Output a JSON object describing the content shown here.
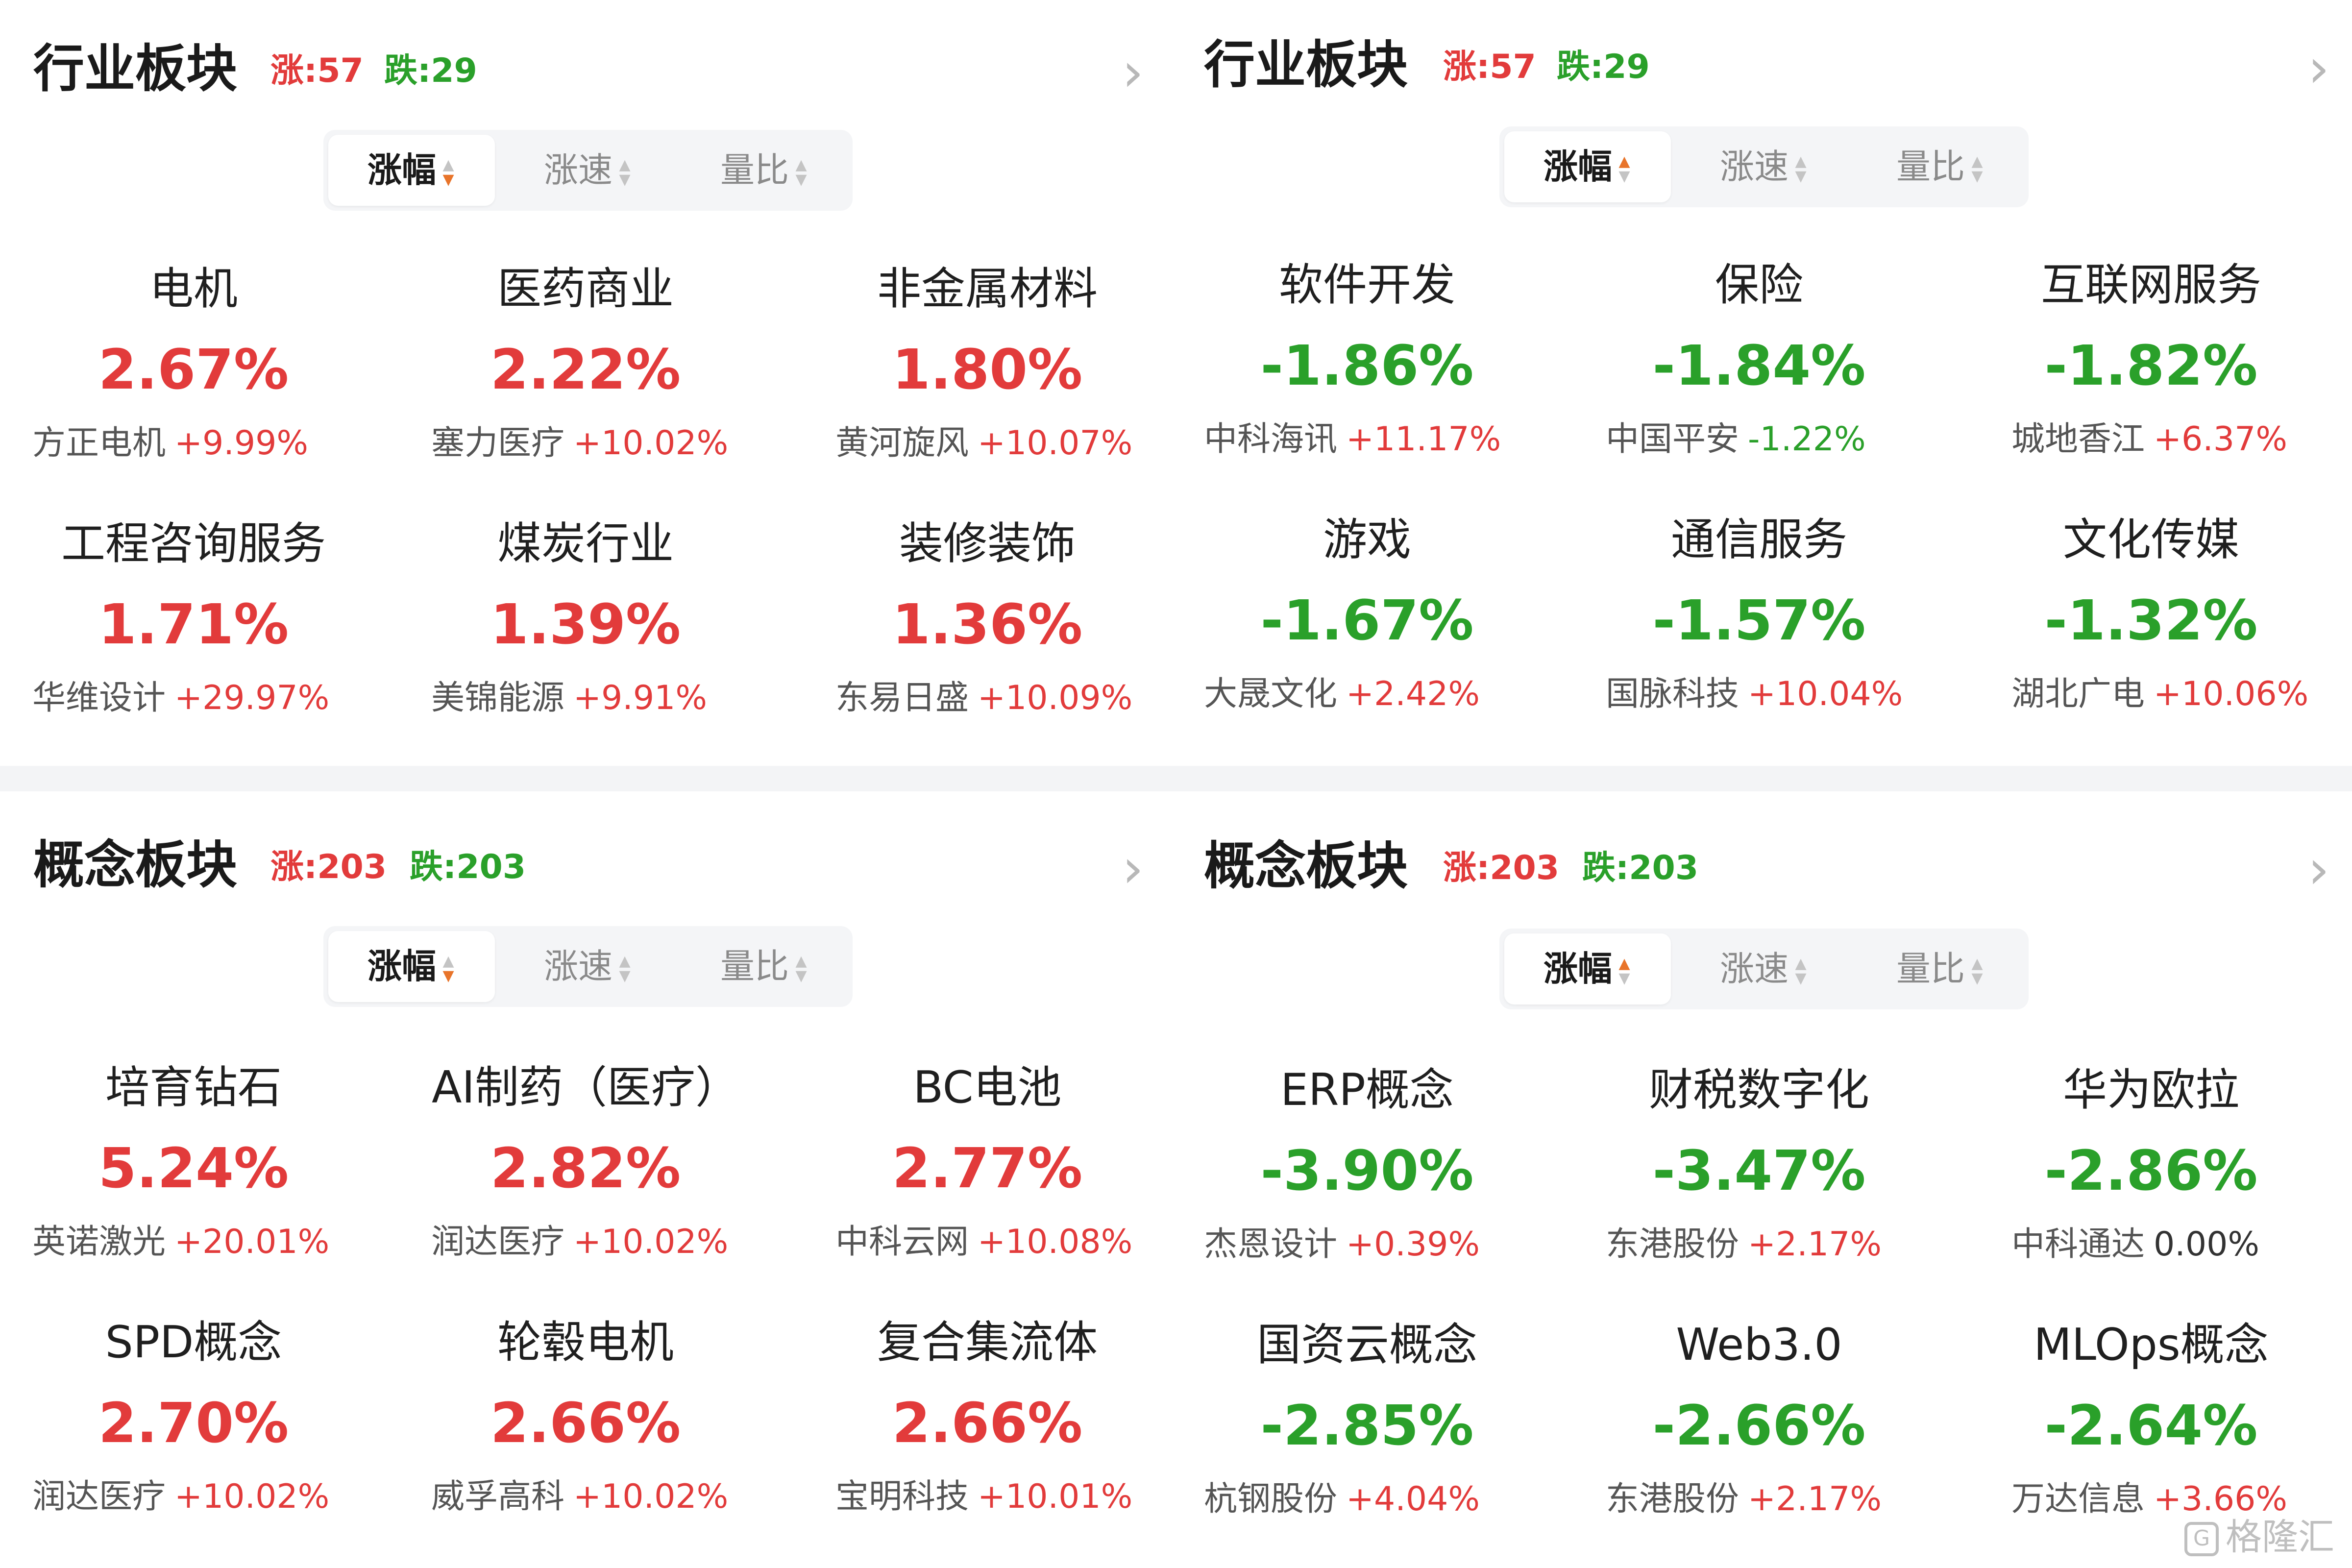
{
  "colors": {
    "up": "#e23b3b",
    "down": "#2aa02a",
    "sort_active": "#e8742a"
  },
  "panels": [
    {
      "title": "行业板块",
      "rise": "涨:57",
      "fall": "跌:29",
      "sort_tabs": [
        "涨幅",
        "涨速",
        "量比"
      ],
      "active_sort_direction": "desc",
      "items": [
        {
          "name": "电机",
          "pct": "2.67%",
          "dir": "up",
          "lead": "方正电机",
          "lead_chg": "+9.99%",
          "lead_dir": "up"
        },
        {
          "name": "医药商业",
          "pct": "2.22%",
          "dir": "up",
          "lead": "塞力医疗",
          "lead_chg": "+10.02%",
          "lead_dir": "up"
        },
        {
          "name": "非金属材料",
          "pct": "1.80%",
          "dir": "up",
          "lead": "黄河旋风",
          "lead_chg": "+10.07%",
          "lead_dir": "up"
        },
        {
          "name": "工程咨询服务",
          "pct": "1.71%",
          "dir": "up",
          "lead": "华维设计",
          "lead_chg": "+29.97%",
          "lead_dir": "up"
        },
        {
          "name": "煤炭行业",
          "pct": "1.39%",
          "dir": "up",
          "lead": "美锦能源",
          "lead_chg": "+9.91%",
          "lead_dir": "up"
        },
        {
          "name": "装修装饰",
          "pct": "1.36%",
          "dir": "up",
          "lead": "东易日盛",
          "lead_chg": "+10.09%",
          "lead_dir": "up"
        }
      ]
    },
    {
      "title": "行业板块",
      "rise": "涨:57",
      "fall": "跌:29",
      "sort_tabs": [
        "涨幅",
        "涨速",
        "量比"
      ],
      "active_sort_direction": "asc",
      "items": [
        {
          "name": "软件开发",
          "pct": "-1.86%",
          "dir": "down",
          "lead": "中科海讯",
          "lead_chg": "+11.17%",
          "lead_dir": "up"
        },
        {
          "name": "保险",
          "pct": "-1.84%",
          "dir": "down",
          "lead": "中国平安",
          "lead_chg": "-1.22%",
          "lead_dir": "down"
        },
        {
          "name": "互联网服务",
          "pct": "-1.82%",
          "dir": "down",
          "lead": "城地香江",
          "lead_chg": "+6.37%",
          "lead_dir": "up"
        },
        {
          "name": "游戏",
          "pct": "-1.67%",
          "dir": "down",
          "lead": "大晟文化",
          "lead_chg": "+2.42%",
          "lead_dir": "up"
        },
        {
          "name": "通信服务",
          "pct": "-1.57%",
          "dir": "down",
          "lead": "国脉科技",
          "lead_chg": "+10.04%",
          "lead_dir": "up"
        },
        {
          "name": "文化传媒",
          "pct": "-1.32%",
          "dir": "down",
          "lead": "湖北广电",
          "lead_chg": "+10.06%",
          "lead_dir": "up"
        }
      ]
    },
    {
      "title": "概念板块",
      "rise": "涨:203",
      "fall": "跌:203",
      "sort_tabs": [
        "涨幅",
        "涨速",
        "量比"
      ],
      "active_sort_direction": "desc",
      "items": [
        {
          "name": "培育钻石",
          "pct": "5.24%",
          "dir": "up",
          "lead": "英诺激光",
          "lead_chg": "+20.01%",
          "lead_dir": "up"
        },
        {
          "name": "AI制药（医疗）",
          "pct": "2.82%",
          "dir": "up",
          "lead": "润达医疗",
          "lead_chg": "+10.02%",
          "lead_dir": "up"
        },
        {
          "name": "BC电池",
          "pct": "2.77%",
          "dir": "up",
          "lead": "中科云网",
          "lead_chg": "+10.08%",
          "lead_dir": "up"
        },
        {
          "name": "SPD概念",
          "pct": "2.70%",
          "dir": "up",
          "lead": "润达医疗",
          "lead_chg": "+10.02%",
          "lead_dir": "up"
        },
        {
          "name": "轮毂电机",
          "pct": "2.66%",
          "dir": "up",
          "lead": "威孚高科",
          "lead_chg": "+10.02%",
          "lead_dir": "up"
        },
        {
          "name": "复合集流体",
          "pct": "2.66%",
          "dir": "up",
          "lead": "宝明科技",
          "lead_chg": "+10.01%",
          "lead_dir": "up"
        }
      ]
    },
    {
      "title": "概念板块",
      "rise": "涨:203",
      "fall": "跌:203",
      "sort_tabs": [
        "涨幅",
        "涨速",
        "量比"
      ],
      "active_sort_direction": "asc",
      "items": [
        {
          "name": "ERP概念",
          "pct": "-3.90%",
          "dir": "down",
          "lead": "杰恩设计",
          "lead_chg": "+0.39%",
          "lead_dir": "up"
        },
        {
          "name": "财税数字化",
          "pct": "-3.47%",
          "dir": "down",
          "lead": "东港股份",
          "lead_chg": "+2.17%",
          "lead_dir": "up"
        },
        {
          "name": "华为欧拉",
          "pct": "-2.86%",
          "dir": "down",
          "lead": "中科通达",
          "lead_chg": "0.00%",
          "lead_dir": "flat"
        },
        {
          "name": "国资云概念",
          "pct": "-2.85%",
          "dir": "down",
          "lead": "杭钢股份",
          "lead_chg": "+4.04%",
          "lead_dir": "up"
        },
        {
          "name": "Web3.0",
          "pct": "-2.66%",
          "dir": "down",
          "lead": "东港股份",
          "lead_chg": "+2.17%",
          "lead_dir": "up"
        },
        {
          "name": "MLOps概念",
          "pct": "-2.64%",
          "dir": "down",
          "lead": "万达信息",
          "lead_chg": "+3.66%",
          "lead_dir": "up"
        }
      ]
    }
  ],
  "watermark": "格隆汇",
  "icons": {
    "more": "chevron-right-icon",
    "sort": "sort-arrows-icon",
    "watermark": "gelonghui-logo-icon"
  }
}
